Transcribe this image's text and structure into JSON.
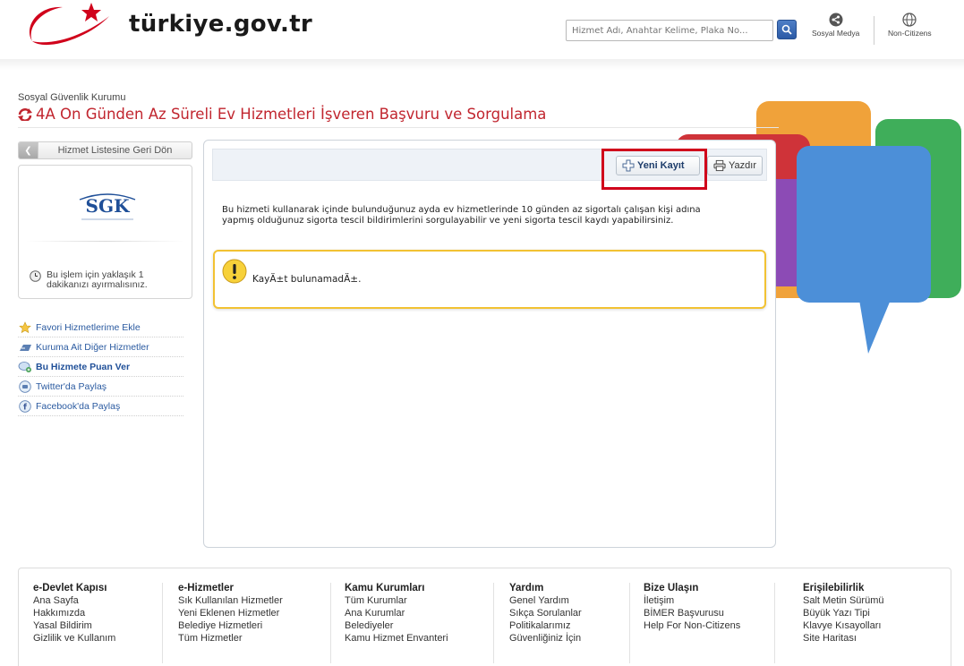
{
  "header": {
    "logo_text": "türkiye.gov.tr",
    "search_placeholder": "Hizmet Adı, Anahtar Kelime, Plaka No...",
    "social_label": "Sosyal Medya",
    "noncitizens_label": "Non-Citizens"
  },
  "page": {
    "institution": "Sosyal Güvenlik Kurumu",
    "title": "4A On Günden Az Süreli Ev Hizmetleri İşveren Başvuru ve Sorgulama"
  },
  "sidebar": {
    "back_label": "Hizmet Listesine Geri Dön",
    "logo_text": "SGK",
    "time_note_line1": "Bu işlem için yaklaşık 1",
    "time_note_line2": "dakikanızı ayırmalısınız.",
    "links": [
      {
        "label": "Favori Hizmetlerime Ekle"
      },
      {
        "label": "Kuruma Ait Diğer Hizmetler"
      },
      {
        "label": "Bu Hizmete Puan Ver"
      },
      {
        "label": "Twitter'da Paylaş"
      },
      {
        "label": "Facebook'da Paylaş"
      }
    ]
  },
  "main": {
    "new_record_label": "Yeni Kayıt",
    "print_label": "Yazdır",
    "description_line1": "Bu hizmeti kullanarak içinde bulunduğunuz ayda ev hizmetlerinde 10 günden az sigortalı çalışan kişi adına",
    "description_line2": "yapmış olduğunuz sigorta tescil bildirimlerini sorgulayabilir ve yeni sigorta tescil kaydı yapabilirsiniz.",
    "alert_message": "KayÄ±t bulunamadÄ±."
  },
  "footer": {
    "columns": [
      {
        "heading": "e-Devlet Kapısı",
        "items": [
          "Ana Sayfa",
          "Hakkımızda",
          "Yasal Bildirim",
          "Gizlilik ve Kullanım"
        ]
      },
      {
        "heading": "e-Hizmetler",
        "items": [
          "Sık Kullanılan Hizmetler",
          "Yeni Eklenen Hizmetler",
          "Belediye Hizmetleri",
          "Tüm Hizmetler"
        ]
      },
      {
        "heading": "Kamu Kurumları",
        "items": [
          "Tüm Kurumlar",
          "Ana Kurumlar",
          "Belediyeler",
          "Kamu Hizmet Envanteri"
        ]
      },
      {
        "heading": "Yardım",
        "items": [
          "Genel Yardım",
          "Sıkça Sorulanlar",
          "Politikalarımız",
          "Güvenliğiniz İçin"
        ]
      },
      {
        "heading": "Bize Ulaşın",
        "items": [
          "İletişim",
          "BİMER Başvurusu",
          "Help For Non-Citizens"
        ]
      },
      {
        "heading": "Erişilebilirlik",
        "items": [
          "Salt Metin Sürümü",
          "Büyük Yazı Tipi",
          "Klavye Kısayolları",
          "Site Haritası"
        ]
      }
    ]
  },
  "colors": {
    "brand_red": "#c1262f",
    "link_blue": "#2a5aa0",
    "alert_yellow": "#f2c233",
    "highlight_red": "#d0021b"
  }
}
